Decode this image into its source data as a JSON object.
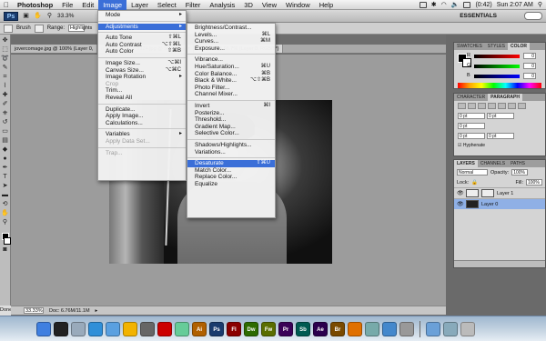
{
  "menubar": {
    "items": [
      "Photoshop",
      "File",
      "Edit",
      "Image",
      "Layer",
      "Select",
      "Filter",
      "Analysis",
      "3D",
      "View",
      "Window",
      "Help"
    ],
    "active_item": "Image",
    "battery": "(0:42)",
    "clock": "Sun 2:07 AM"
  },
  "appbar": {
    "zoom": "33.3%",
    "workspace": "ESSENTIALS"
  },
  "options": {
    "brush_label": "Brush",
    "range_label": "Range:",
    "range_value": "Highlights"
  },
  "tabs": [
    "jovercomage.jpg @ 100% (Layer 0,",
    "n, RGB/8*) *",
    "2124.jpg @ 50% (Layer",
    "222.psd @ 66.7% (Layer 0, RGB/8*)"
  ],
  "status": {
    "zoom": "33.33%",
    "doc": "Doc: 6.76M/11.1M"
  },
  "image_menu": [
    {
      "label": "Mode",
      "submenu": true
    },
    {
      "sep": true
    },
    {
      "label": "Adjustments",
      "submenu": true,
      "highlight": true
    },
    {
      "sep": true
    },
    {
      "label": "Auto Tone",
      "shortcut": "⇧⌘L"
    },
    {
      "label": "Auto Contrast",
      "shortcut": "⌥⇧⌘L"
    },
    {
      "label": "Auto Color",
      "shortcut": "⇧⌘B"
    },
    {
      "sep": true
    },
    {
      "label": "Image Size...",
      "shortcut": "⌥⌘I"
    },
    {
      "label": "Canvas Size...",
      "shortcut": "⌥⌘C"
    },
    {
      "label": "Image Rotation",
      "submenu": true
    },
    {
      "label": "Crop",
      "disabled": true
    },
    {
      "label": "Trim..."
    },
    {
      "label": "Reveal All"
    },
    {
      "sep": true
    },
    {
      "label": "Duplicate..."
    },
    {
      "label": "Apply Image..."
    },
    {
      "label": "Calculations..."
    },
    {
      "sep": true
    },
    {
      "label": "Variables",
      "submenu": true
    },
    {
      "label": "Apply Data Set...",
      "disabled": true
    },
    {
      "sep": true
    },
    {
      "label": "Trap...",
      "disabled": true
    }
  ],
  "adjustments_menu": [
    {
      "label": "Brightness/Contrast..."
    },
    {
      "label": "Levels...",
      "shortcut": "⌘L"
    },
    {
      "label": "Curves...",
      "shortcut": "⌘M"
    },
    {
      "label": "Exposure..."
    },
    {
      "sep": true
    },
    {
      "label": "Vibrance..."
    },
    {
      "label": "Hue/Saturation...",
      "shortcut": "⌘U"
    },
    {
      "label": "Color Balance...",
      "shortcut": "⌘B"
    },
    {
      "label": "Black & White...",
      "shortcut": "⌥⇧⌘B"
    },
    {
      "label": "Photo Filter..."
    },
    {
      "label": "Channel Mixer..."
    },
    {
      "sep": true
    },
    {
      "label": "Invert",
      "shortcut": "⌘I"
    },
    {
      "label": "Posterize..."
    },
    {
      "label": "Threshold..."
    },
    {
      "label": "Gradient Map..."
    },
    {
      "label": "Selective Color..."
    },
    {
      "sep": true
    },
    {
      "label": "Shadows/Highlights..."
    },
    {
      "label": "Variations..."
    },
    {
      "sep": true
    },
    {
      "label": "Desaturate",
      "shortcut": "⇧⌘U",
      "highlight": true
    },
    {
      "label": "Match Color..."
    },
    {
      "label": "Replace Color..."
    },
    {
      "label": "Equalize"
    }
  ],
  "color_panel": {
    "tabs": [
      "SWATCHES",
      "STYLES",
      "COLOR"
    ],
    "active_tab": "COLOR",
    "channels": [
      {
        "name": "R",
        "value": "0",
        "gradient": "linear-gradient(90deg,#000,#f00)"
      },
      {
        "name": "G",
        "value": "0",
        "gradient": "linear-gradient(90deg,#000,#0f0)"
      },
      {
        "name": "B",
        "value": "0",
        "gradient": "linear-gradient(90deg,#000,#00f)"
      }
    ]
  },
  "para_panel": {
    "tabs": [
      "CHARACTER",
      "PARAGRAPH"
    ],
    "active_tab": "PARAGRAPH",
    "fields": [
      "0 pt",
      "0 pt",
      "0 pt",
      "0 pt",
      "0 pt"
    ],
    "hyphenate": "Hyphenate"
  },
  "layers_panel": {
    "tabs": [
      "LAYERS",
      "CHANNELS",
      "PATHS"
    ],
    "active_tab": "LAYERS",
    "blend": "Normal",
    "opacity_label": "Opacity:",
    "opacity": "100%",
    "lock_label": "Lock:",
    "fill_label": "Fill:",
    "fill": "100%",
    "layers": [
      {
        "name": "Layer 1",
        "selected": false
      },
      {
        "name": "Layer 0",
        "selected": true
      }
    ]
  },
  "dock": {
    "apps": [
      {
        "icon": "finder-icon",
        "label": "",
        "color": "#3f7fe0"
      },
      {
        "icon": "dashboard-icon",
        "label": "",
        "color": "#222"
      },
      {
        "icon": "mail-icon",
        "label": "",
        "color": "#9ab"
      },
      {
        "icon": "safari-icon",
        "label": "",
        "color": "#2f8fd8"
      },
      {
        "icon": "itunes-icon",
        "label": "",
        "color": "#5aa0e0"
      },
      {
        "icon": "adium-icon",
        "label": "",
        "color": "#f2b300"
      },
      {
        "icon": "photo-icon",
        "label": "",
        "color": "#666"
      },
      {
        "icon": "acrobat-icon",
        "label": "",
        "color": "#c00"
      },
      {
        "icon": "ichat-icon",
        "label": "",
        "color": "#6c9"
      },
      {
        "icon": "illustrator-icon",
        "label": "Ai",
        "color": "#b06000"
      },
      {
        "icon": "photoshop-icon",
        "label": "Ps",
        "color": "#1a3b6d"
      },
      {
        "icon": "flash-icon",
        "label": "Fl",
        "color": "#8a0000"
      },
      {
        "icon": "dreamweaver-icon",
        "label": "Dw",
        "color": "#2d6b00"
      },
      {
        "icon": "fireworks-icon",
        "label": "Fw",
        "color": "#5a6e00"
      },
      {
        "icon": "premiere-icon",
        "label": "Pr",
        "color": "#3a0057"
      },
      {
        "icon": "soundbooth-icon",
        "label": "Sb",
        "color": "#005a52"
      },
      {
        "icon": "aftereffects-icon",
        "label": "Ae",
        "color": "#2b004d"
      },
      {
        "icon": "bridge-icon",
        "label": "Br",
        "color": "#7a4a00"
      },
      {
        "icon": "vlc-icon",
        "label": "",
        "color": "#e07000"
      },
      {
        "icon": "preview-icon",
        "label": "",
        "color": "#7aa"
      },
      {
        "icon": "globe-icon",
        "label": "",
        "color": "#48c"
      },
      {
        "icon": "speaker-icon",
        "label": "",
        "color": "#999"
      }
    ],
    "trail": [
      {
        "icon": "folder-icon",
        "color": "#6aa0d8"
      },
      {
        "icon": "downloads-icon",
        "color": "#8ab"
      },
      {
        "icon": "trash-icon",
        "color": "#bbb"
      }
    ]
  }
}
